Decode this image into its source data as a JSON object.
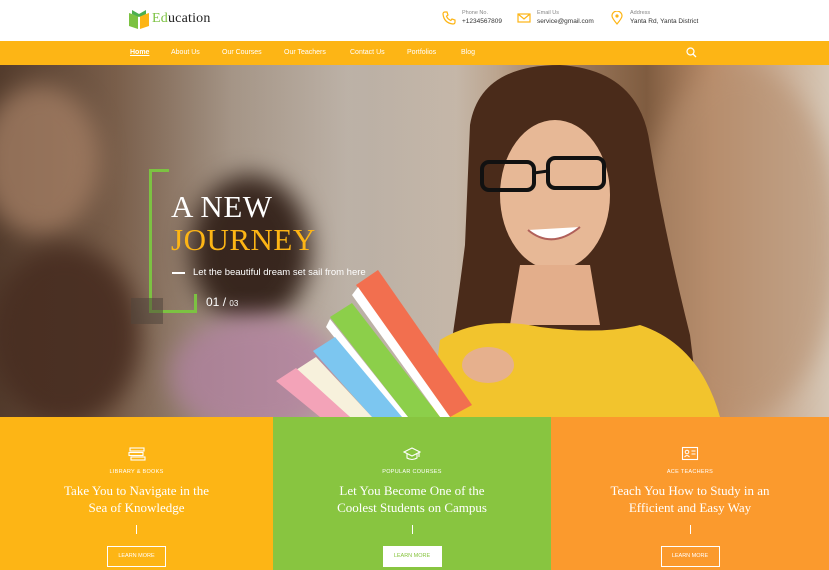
{
  "brand": {
    "prefix": "Ed",
    "suffix": "ucation"
  },
  "contact": {
    "phone": {
      "label": "Phone No.",
      "value": "+1234567809"
    },
    "email": {
      "label": "Email Us",
      "value": "service@gmail.com"
    },
    "address": {
      "label": "Address",
      "value": "Yanta Rd, Yanta District"
    }
  },
  "nav": {
    "items": [
      "Home",
      "About Us",
      "Our Courses",
      "Our Teachers",
      "Contact Us",
      "Portfolios",
      "Blog"
    ],
    "active": "Home"
  },
  "hero": {
    "line1": "A NEW",
    "line2": "JOURNEY",
    "subtitle": "Let the beautiful dream set sail from here",
    "slide_current": "01",
    "slide_separator": "/",
    "slide_total": "03"
  },
  "features": [
    {
      "category": "LIBRARY & BOOKS",
      "title_line1": "Take You to Navigate in the",
      "title_line2": "Sea of Knowledge",
      "button": "LEARN MORE",
      "icon": "books-icon",
      "color": "#fdb515"
    },
    {
      "category": "POPULAR COURSES",
      "title_line1": "Let You Become One of the",
      "title_line2": "Coolest Students on Campus",
      "button": "LEARN MORE",
      "icon": "graduation-cap-icon",
      "color": "#88c540"
    },
    {
      "category": "ACE TEACHERS",
      "title_line1": "Teach You How to Study in an",
      "title_line2": "Efficient and Easy Way",
      "button": "LEARN MORE",
      "icon": "teacher-board-icon",
      "color": "#fb9a2d"
    }
  ],
  "colors": {
    "accent": "#fdb515",
    "green": "#88c540",
    "orange": "#fb9a2d",
    "logo_green": "#7cc242"
  }
}
